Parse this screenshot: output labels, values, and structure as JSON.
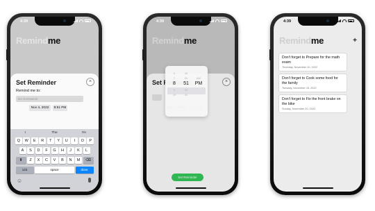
{
  "status": {
    "time": "4:39"
  },
  "app_title": {
    "part1": "Remind",
    "part2": "me"
  },
  "sheet": {
    "title": "Set Reminder",
    "close_symbol": "×",
    "field_label": "Remind me to:",
    "field_placeholder": "Do Homework",
    "date": "Nov 4, 2022",
    "time": "8:51 PM"
  },
  "keyboard": {
    "suggestions": [
      "I",
      "The",
      "I'm"
    ],
    "row1": [
      "Q",
      "W",
      "E",
      "R",
      "T",
      "Y",
      "U",
      "I",
      "O",
      "P"
    ],
    "row2": [
      "A",
      "S",
      "D",
      "F",
      "G",
      "H",
      "J",
      "K",
      "L"
    ],
    "row3": [
      "Z",
      "X",
      "C",
      "V",
      "B",
      "N",
      "M"
    ],
    "shift_icon": "⬆",
    "delete_icon": "⌫",
    "numbers_key": "123",
    "space_key": "space",
    "done_key": "done",
    "emoji_icon": "☺",
    "mic_icon": "🎤"
  },
  "picker": {
    "hours": [
      "6",
      "7",
      "8",
      "9",
      "10"
    ],
    "minutes": [
      "49",
      "50",
      "51",
      "52",
      "53"
    ],
    "ampm": [
      "AM",
      "PM"
    ],
    "selected": {
      "hour": "8",
      "minute": "51",
      "ampm": "PM"
    }
  },
  "set_button": "Set Reminder",
  "list": {
    "add_symbol": "+",
    "items": [
      {
        "title": "Don't forget to Prepare for the math exam",
        "date": "Thursday, November 10, 2022"
      },
      {
        "title": "Don't forget to Cook some food for the family",
        "date": "Tuesday, November 15, 2022"
      },
      {
        "title": "Don't forget to Fix the front brake on the bike",
        "date": "Sunday, November 20, 2022"
      }
    ]
  },
  "colors": {
    "accent": "#0a84ff",
    "green": "#34c759",
    "screen_bg": "#c9c9c9"
  }
}
